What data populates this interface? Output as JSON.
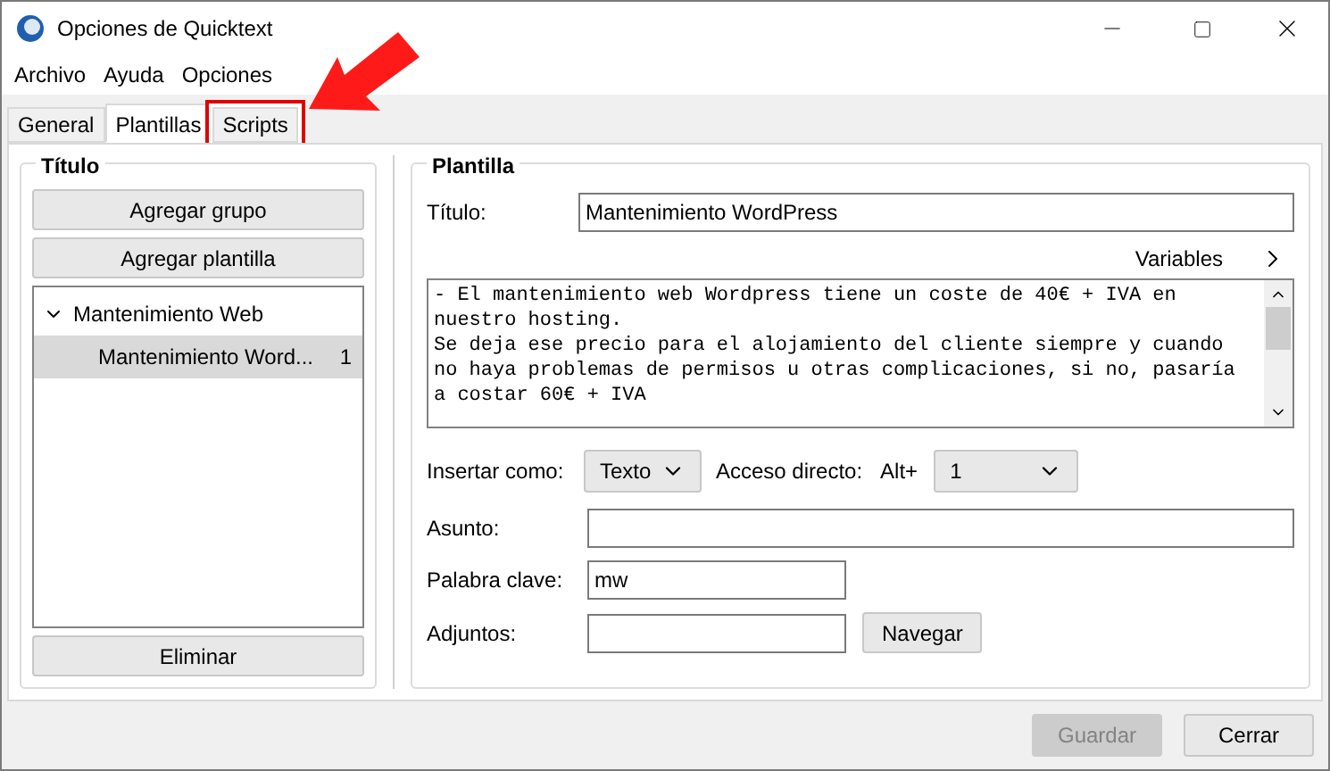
{
  "window": {
    "title": "Opciones de Quicktext"
  },
  "menu": [
    "Archivo",
    "Ayuda",
    "Opciones"
  ],
  "tabs": [
    {
      "label": "General",
      "selected": false
    },
    {
      "label": "Plantillas",
      "selected": true
    },
    {
      "label": "Scripts",
      "selected": false,
      "highlighted": true
    }
  ],
  "left_panel": {
    "title": "Título",
    "buttons": [
      "Agregar grupo",
      "Agregar plantilla"
    ],
    "tree": [
      {
        "label": "Mantenimiento Web",
        "expanded": true,
        "selected": false,
        "children": [
          {
            "label": "Mantenimiento Word...",
            "shortcut": "1",
            "selected": true
          }
        ]
      }
    ],
    "delete_button": "Eliminar"
  },
  "right_panel": {
    "title": "Plantilla",
    "title_field": {
      "label": "Título:",
      "value": "Mantenimiento WordPress"
    },
    "variables": "Variables",
    "body": [
      "- El mantenimiento web Wordpress tiene un coste de 40€ + IVA en nuestro hosting.",
      "Se deja ese precio para el alojamiento del cliente siempre y cuando no haya problemas de permisos u otras complicaciones, si no, pasaría a costar 60€ + IVA"
    ],
    "insert_as": {
      "label": "Insertar como:",
      "value": "Texto"
    },
    "shortcut": {
      "label": "Acceso directo:",
      "prefix": "Alt+",
      "value": "1"
    },
    "subject": {
      "label": "Asunto:"
    },
    "keyword": {
      "label": "Palabra clave:",
      "value": "mw"
    },
    "attachments": {
      "label": "Adjuntos:",
      "button": "Navegar"
    }
  },
  "footer": [
    {
      "label": "Guardar",
      "disabled": true
    },
    {
      "label": "Cerrar",
      "disabled": false
    }
  ]
}
